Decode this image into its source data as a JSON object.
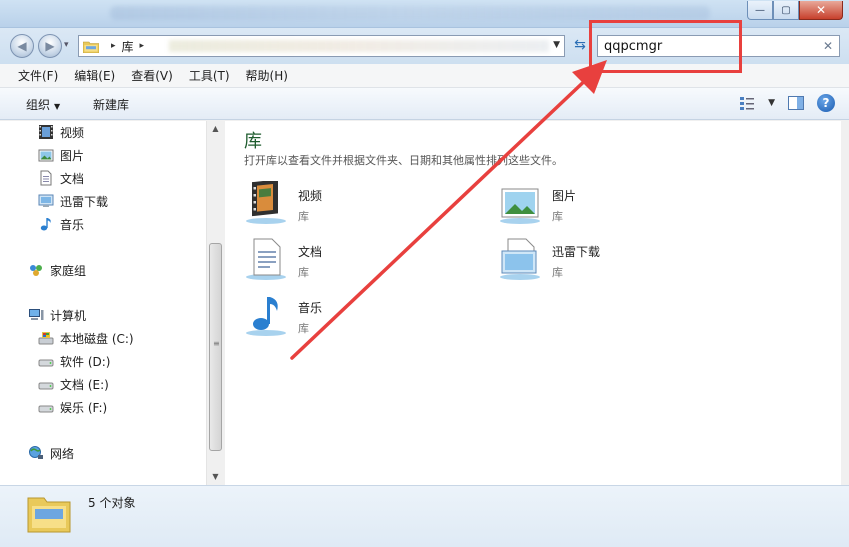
{
  "window": {
    "minimize_glyph": "—",
    "maximize_glyph": "▢",
    "close_glyph": "✕"
  },
  "address": {
    "crumb": "库",
    "separator": "▸"
  },
  "search": {
    "value": "qqpcmgr",
    "clear_glyph": "✕"
  },
  "menu": [
    "文件(F)",
    "编辑(E)",
    "查看(V)",
    "工具(T)",
    "帮助(H)"
  ],
  "commands": {
    "organize": "组织",
    "organize_caret": "▼",
    "new_library": "新建库",
    "help_glyph": "?"
  },
  "nav": {
    "libraries": [
      "视频",
      "图片",
      "文档",
      "迅雷下载",
      "音乐"
    ],
    "homegroup": "家庭组",
    "computer": "计算机",
    "drives": [
      "本地磁盘 (C:)",
      "软件 (D:)",
      "文档 (E:)",
      "娱乐 (F:)"
    ],
    "network": "网络"
  },
  "main": {
    "title": "库",
    "description": "打开库以查看文件并根据文件夹、日期和其他属性排列这些文件。",
    "items": [
      {
        "name": "视频",
        "type": "库"
      },
      {
        "name": "图片",
        "type": "库"
      },
      {
        "name": "文档",
        "type": "库"
      },
      {
        "name": "迅雷下载",
        "type": "库"
      },
      {
        "name": "音乐",
        "type": "库"
      }
    ]
  },
  "status": {
    "text": "5 个对象"
  },
  "colors": {
    "annotation": "#e8403e",
    "title_green": "#1e5c2e"
  }
}
